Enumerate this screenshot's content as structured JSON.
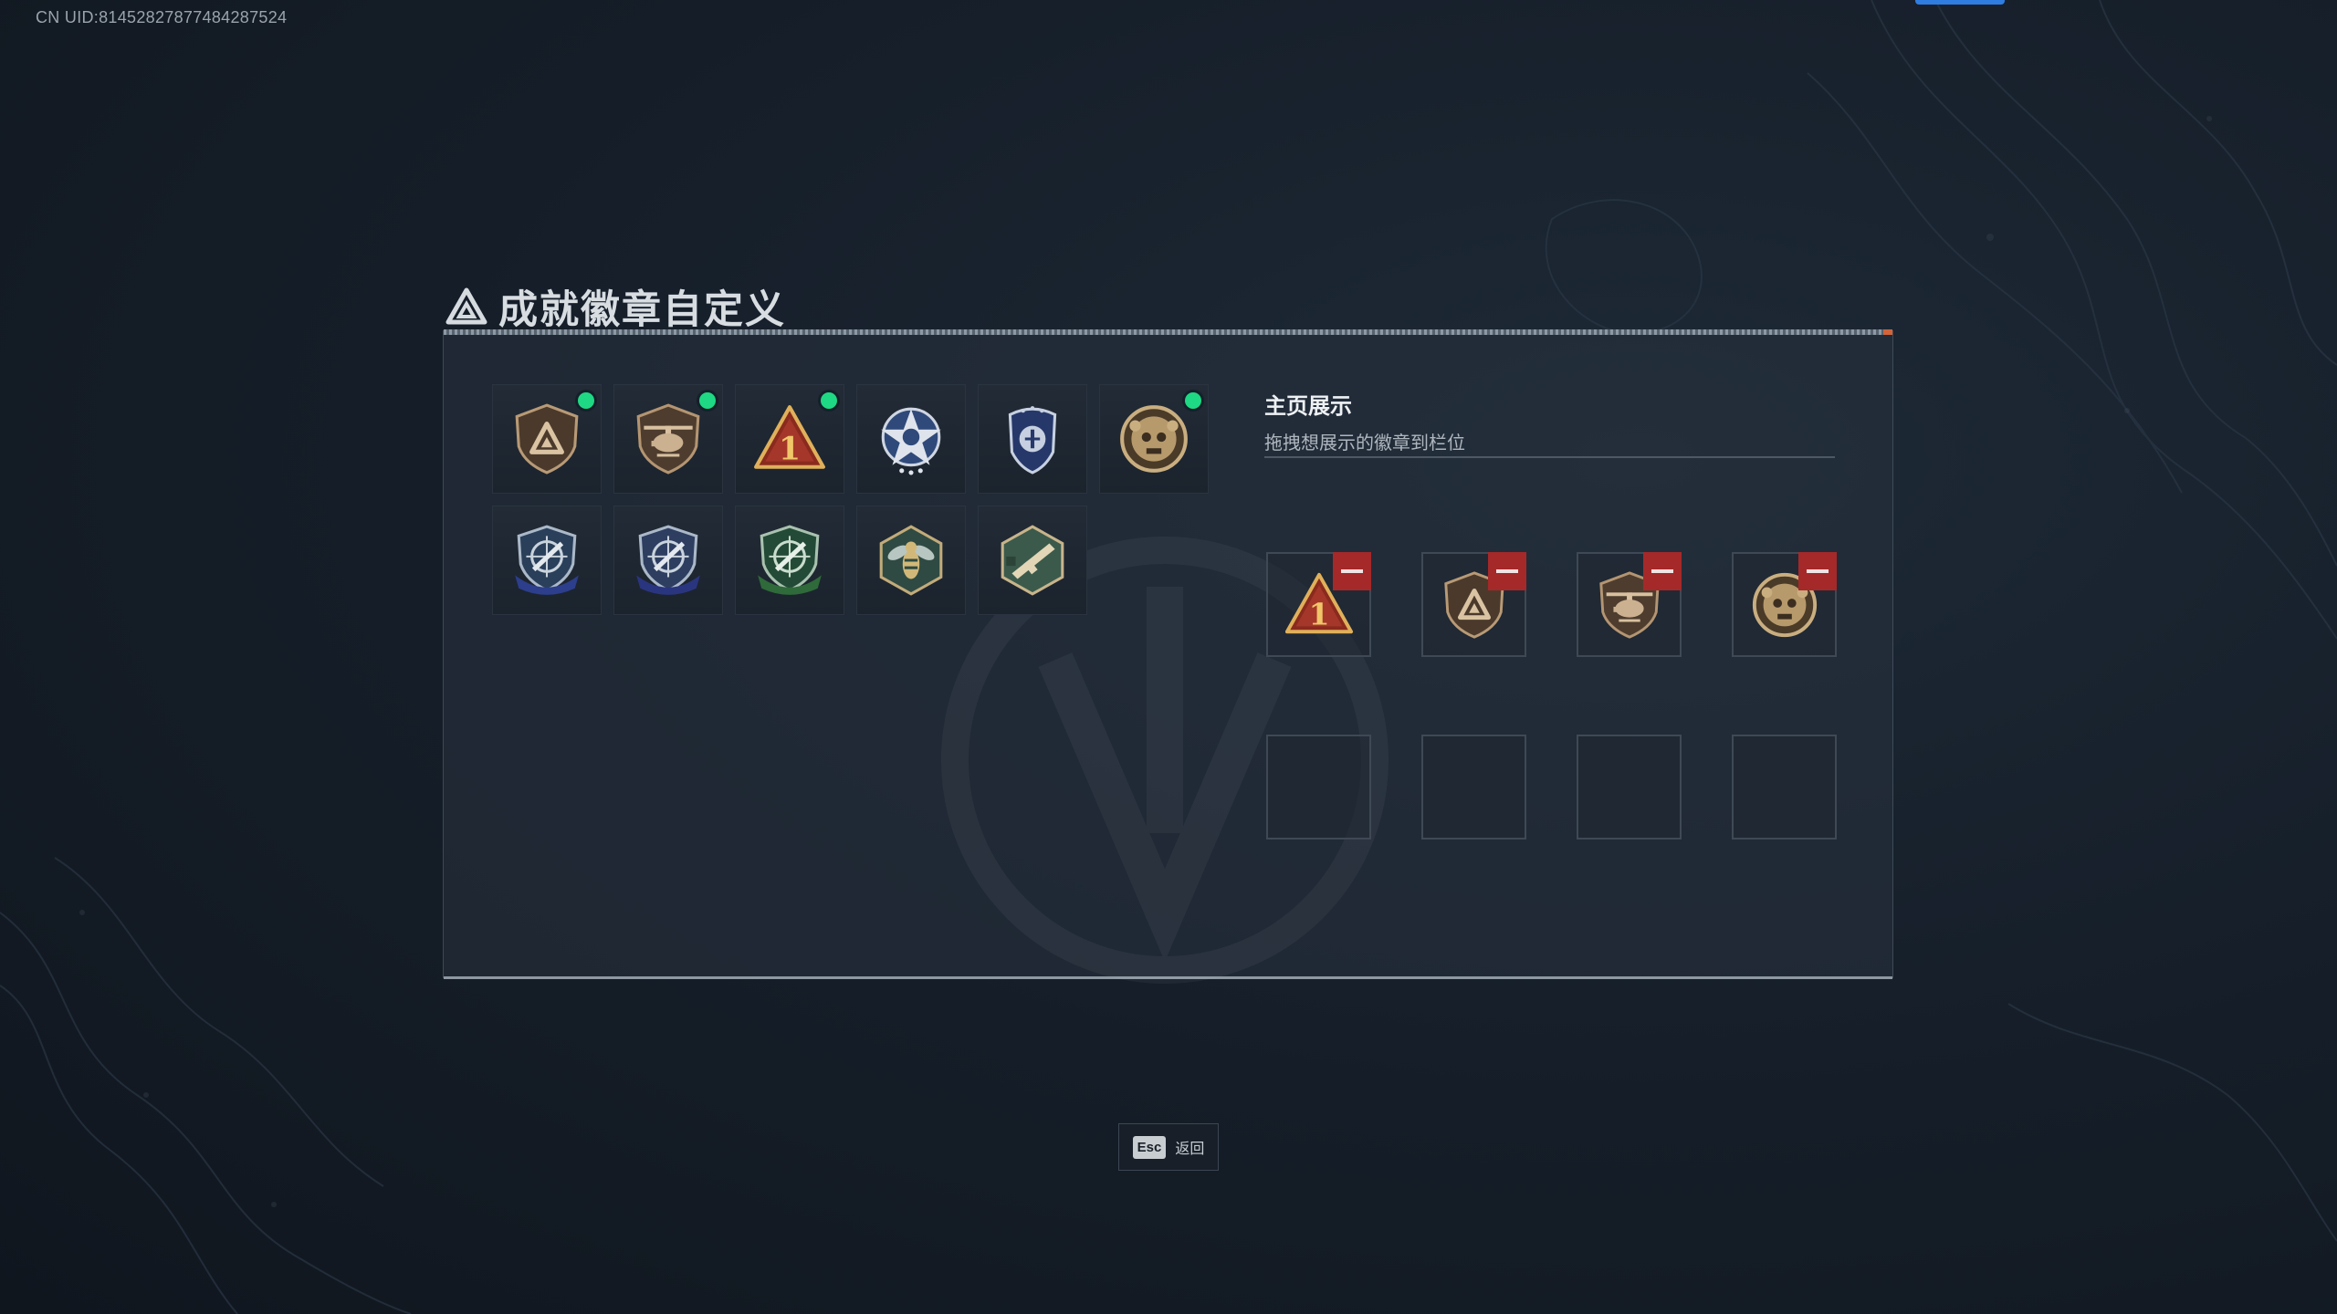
{
  "uid_text": "CN UID:81452827877484287524",
  "title": {
    "text": "成就徽章自定义",
    "icon": "triangle-a-logo-icon"
  },
  "badges": [
    {
      "name": "bronze-shield-triangle-badge",
      "selected": true
    },
    {
      "name": "helicopter-shield-badge",
      "selected": true
    },
    {
      "name": "red-triangle-number-one-badge",
      "selected": true
    },
    {
      "name": "silver-star-medal-badge",
      "selected": false
    },
    {
      "name": "blue-police-shield-badge",
      "selected": false
    },
    {
      "name": "gold-skull-medallion-badge",
      "selected": true
    },
    {
      "name": "blue-crosshair-knife-badge",
      "selected": false
    },
    {
      "name": "blue-crosshair-knife-badge-2",
      "selected": false
    },
    {
      "name": "green-crosshair-knife-badge",
      "selected": false
    },
    {
      "name": "hornet-hexagon-badge",
      "selected": false
    },
    {
      "name": "rifle-hexagon-badge",
      "selected": false
    }
  ],
  "showcase": {
    "title": "主页展示",
    "subtitle": "拖拽想展示的徽章到栏位",
    "slots": [
      {
        "badge": "red-triangle-number-one-badge"
      },
      {
        "badge": "bronze-shield-triangle-badge"
      },
      {
        "badge": "helicopter-shield-badge"
      },
      {
        "badge": "gold-skull-medallion-badge"
      },
      {
        "badge": null
      },
      {
        "badge": null
      },
      {
        "badge": null
      },
      {
        "badge": null
      }
    ]
  },
  "esc": {
    "key": "Esc",
    "label": "返回"
  },
  "colors": {
    "selected_dot": "#1fd883",
    "remove": "#a52929",
    "accent": "#2f7de1"
  }
}
